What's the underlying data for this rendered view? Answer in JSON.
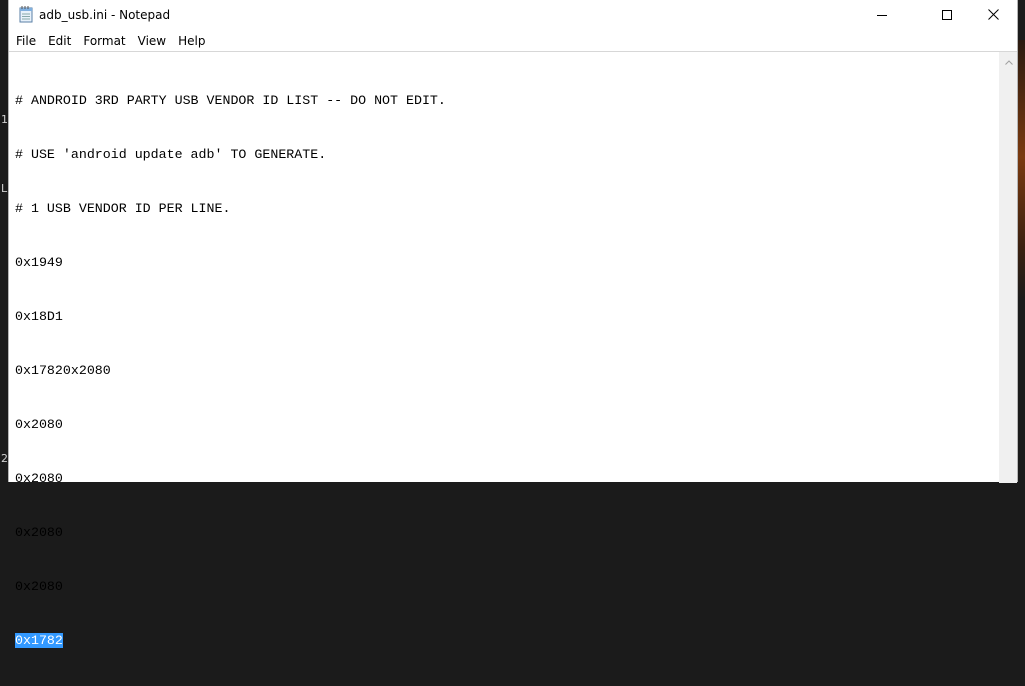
{
  "window": {
    "title": "adb_usb.ini - Notepad",
    "icon": "notepad-icon",
    "controls": [
      "minimize-icon",
      "maximize-icon",
      "close-icon"
    ]
  },
  "menu": [
    {
      "label": "File"
    },
    {
      "label": "Edit"
    },
    {
      "label": "Format"
    },
    {
      "label": "View"
    },
    {
      "label": "Help"
    }
  ],
  "editor": {
    "lines": [
      "# ANDROID 3RD PARTY USB VENDOR ID LIST -- DO NOT EDIT.",
      "# USE 'android update adb' TO GENERATE.",
      "# 1 USB VENDOR ID PER LINE.",
      "0x1949",
      "0x18D1",
      "0x17820x2080",
      "0x2080",
      "0x2080",
      "0x2080",
      "0x2080",
      "0x1782"
    ],
    "selected_line_index": 10
  },
  "desktop": {
    "left_edge_chars": [
      "1",
      "L",
      "2"
    ]
  }
}
